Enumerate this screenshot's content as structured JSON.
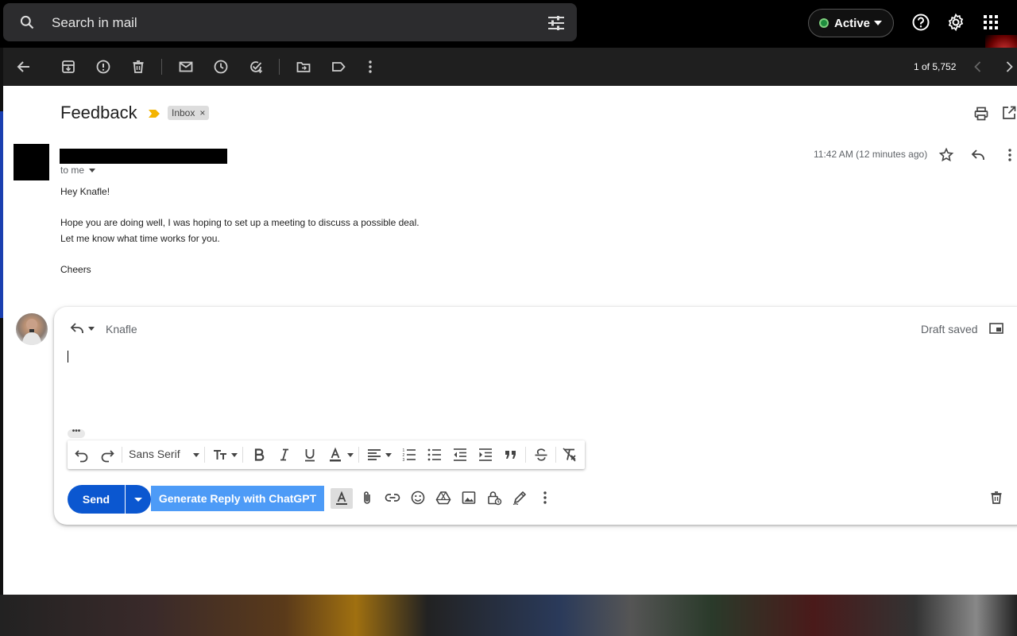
{
  "search": {
    "placeholder": "Search in mail"
  },
  "status": {
    "label": "Active"
  },
  "toolbar": {
    "pager": "1 of 5,752"
  },
  "message": {
    "subject": "Feedback",
    "label_chip": "Inbox",
    "label_chip_close": "×",
    "recipient": "to me",
    "timestamp": "11:42 AM (12 minutes ago)",
    "body": {
      "greeting": "Hey Knafle!",
      "line1": "Hope you are doing well, I was hoping to set up a meeting to discuss a possible deal.",
      "line2": "Let me know what time works for you.",
      "signoff": "Cheers"
    }
  },
  "reply": {
    "to": "Knafle",
    "status": "Draft saved",
    "more_dots": "•••",
    "font": "Sans Serif",
    "send_label": "Send",
    "chatgpt_label": "Generate Reply with ChatGPT"
  },
  "colors": {
    "accent": "#0b57d0",
    "chatgpt": "#4d9bf7",
    "active_dot": "#1e8e3e"
  }
}
